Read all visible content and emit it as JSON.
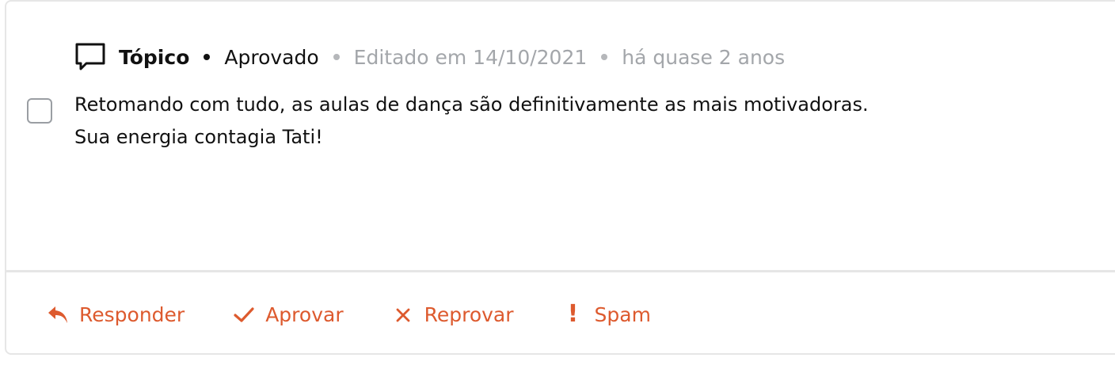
{
  "meta": {
    "type_label": "Tópico",
    "status": "Aprovado",
    "edited": "Editado em 14/10/2021",
    "age": "há quase 2 anos"
  },
  "content": {
    "line1": "Retomando com tudo, as aulas de dança são definitivamente as mais motivadoras.",
    "line2": "Sua energia contagia Tati!"
  },
  "actions": {
    "reply": "Responder",
    "approve": "Aprovar",
    "reject": "Reprovar",
    "spam": "Spam",
    "spam_icon_glyph": "!"
  },
  "colors": {
    "accent": "#dd5a2e",
    "muted_text": "#a3a6aa",
    "border": "#e6e6e6",
    "text": "#111111"
  },
  "icons": {
    "topic": "speech-bubble-icon",
    "reply": "reply-arrow-icon",
    "approve": "check-icon",
    "reject": "close-icon",
    "spam": "exclamation-icon"
  }
}
